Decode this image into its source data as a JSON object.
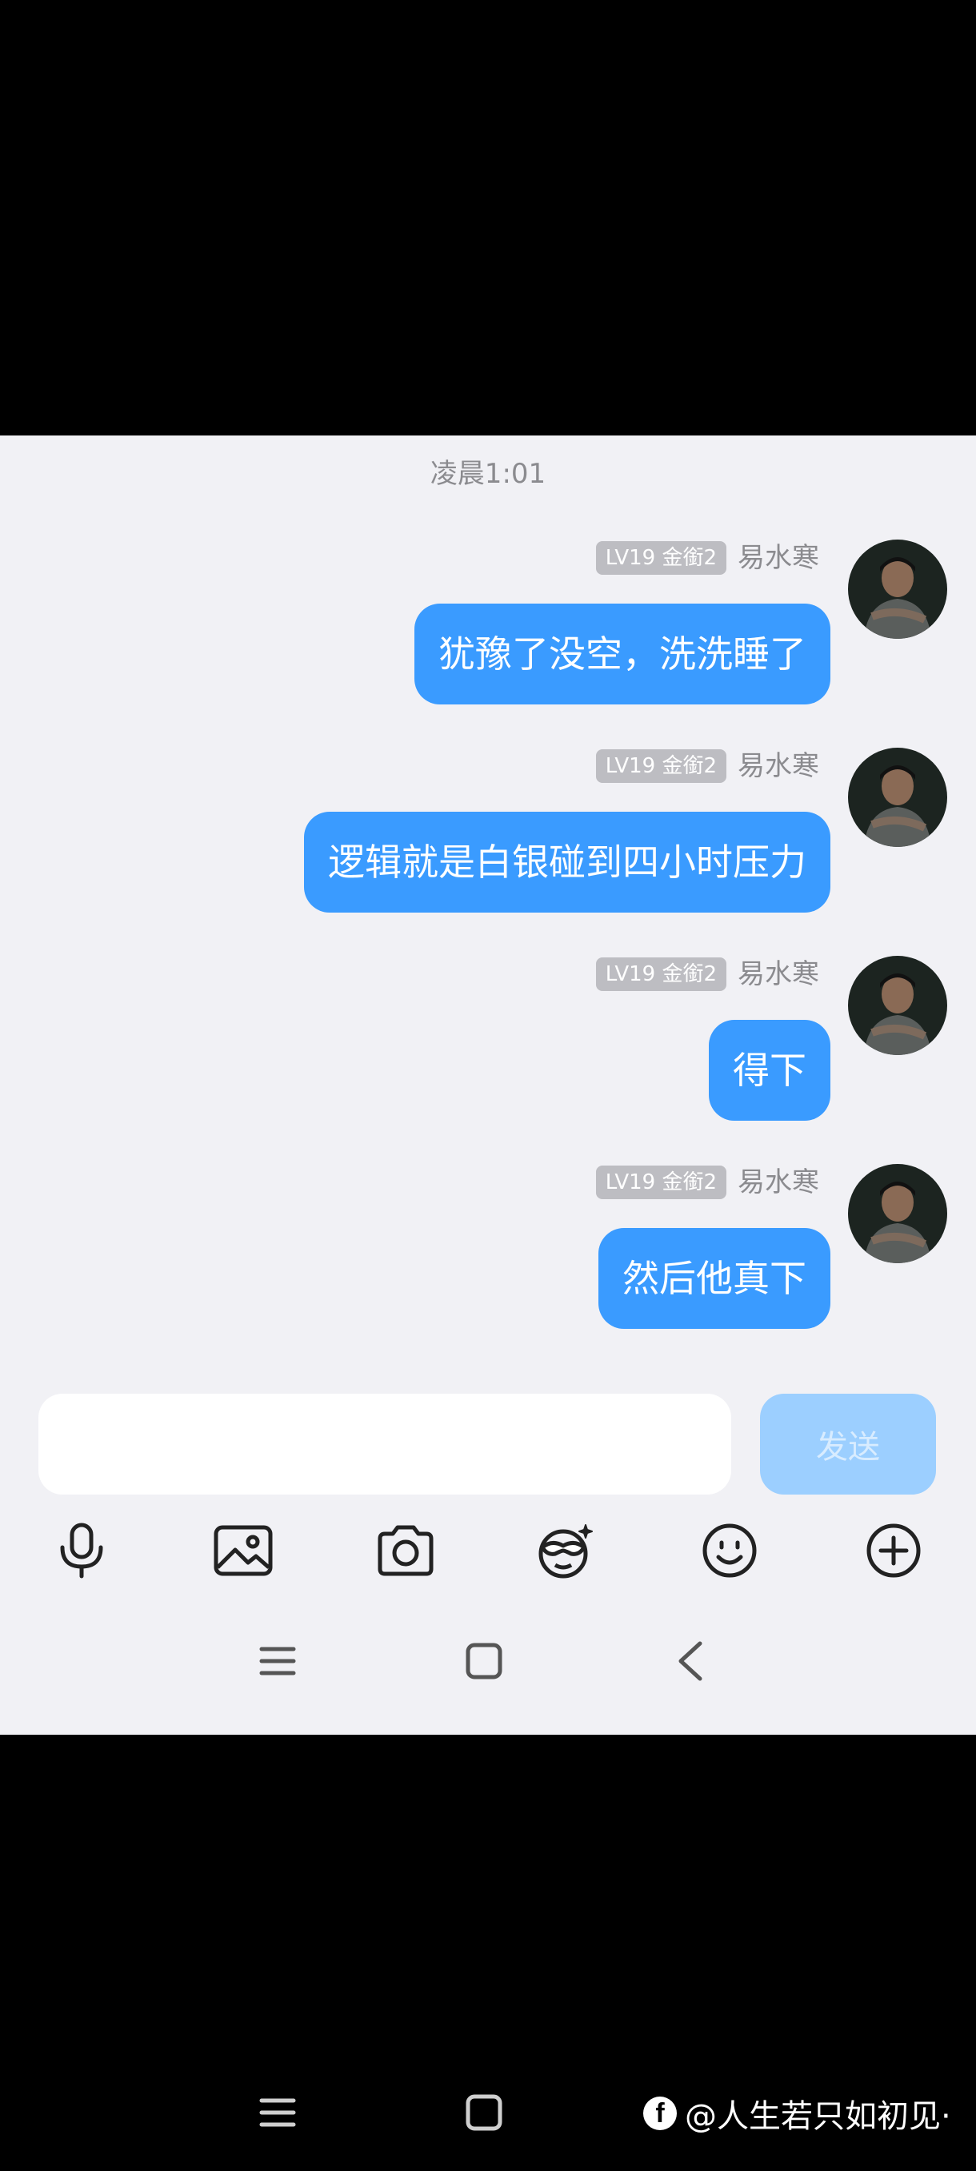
{
  "chat": {
    "timestamp": "凌晨1:01",
    "messages": [
      {
        "level": "LV19 金銜2",
        "sender": "易水寒",
        "text": "犹豫了没空，洗洗睡了"
      },
      {
        "level": "LV19 金銜2",
        "sender": "易水寒",
        "text": "逻辑就是白银碰到四小时压力"
      },
      {
        "level": "LV19 金銜2",
        "sender": "易水寒",
        "text": "得下"
      },
      {
        "level": "LV19 金銜2",
        "sender": "易水寒",
        "text": "然后他真下"
      }
    ]
  },
  "composer": {
    "input_value": "",
    "send_label": "发送"
  },
  "toolbar": {
    "icons": [
      "microphone-icon",
      "image-icon",
      "camera-icon",
      "mask-emoji-icon",
      "smiley-icon",
      "plus-circle-icon"
    ]
  },
  "system_nav": {
    "icons": [
      "menu-icon",
      "home-square-icon",
      "back-chevron-icon"
    ]
  },
  "watermark": {
    "logo_letter": "f",
    "text": "@人生若只如初见·"
  },
  "colors": {
    "bubble": "#3a9bff",
    "send_button": "#9ccfff",
    "background": "#f1f1f5",
    "badge": "#bdbdc2"
  }
}
